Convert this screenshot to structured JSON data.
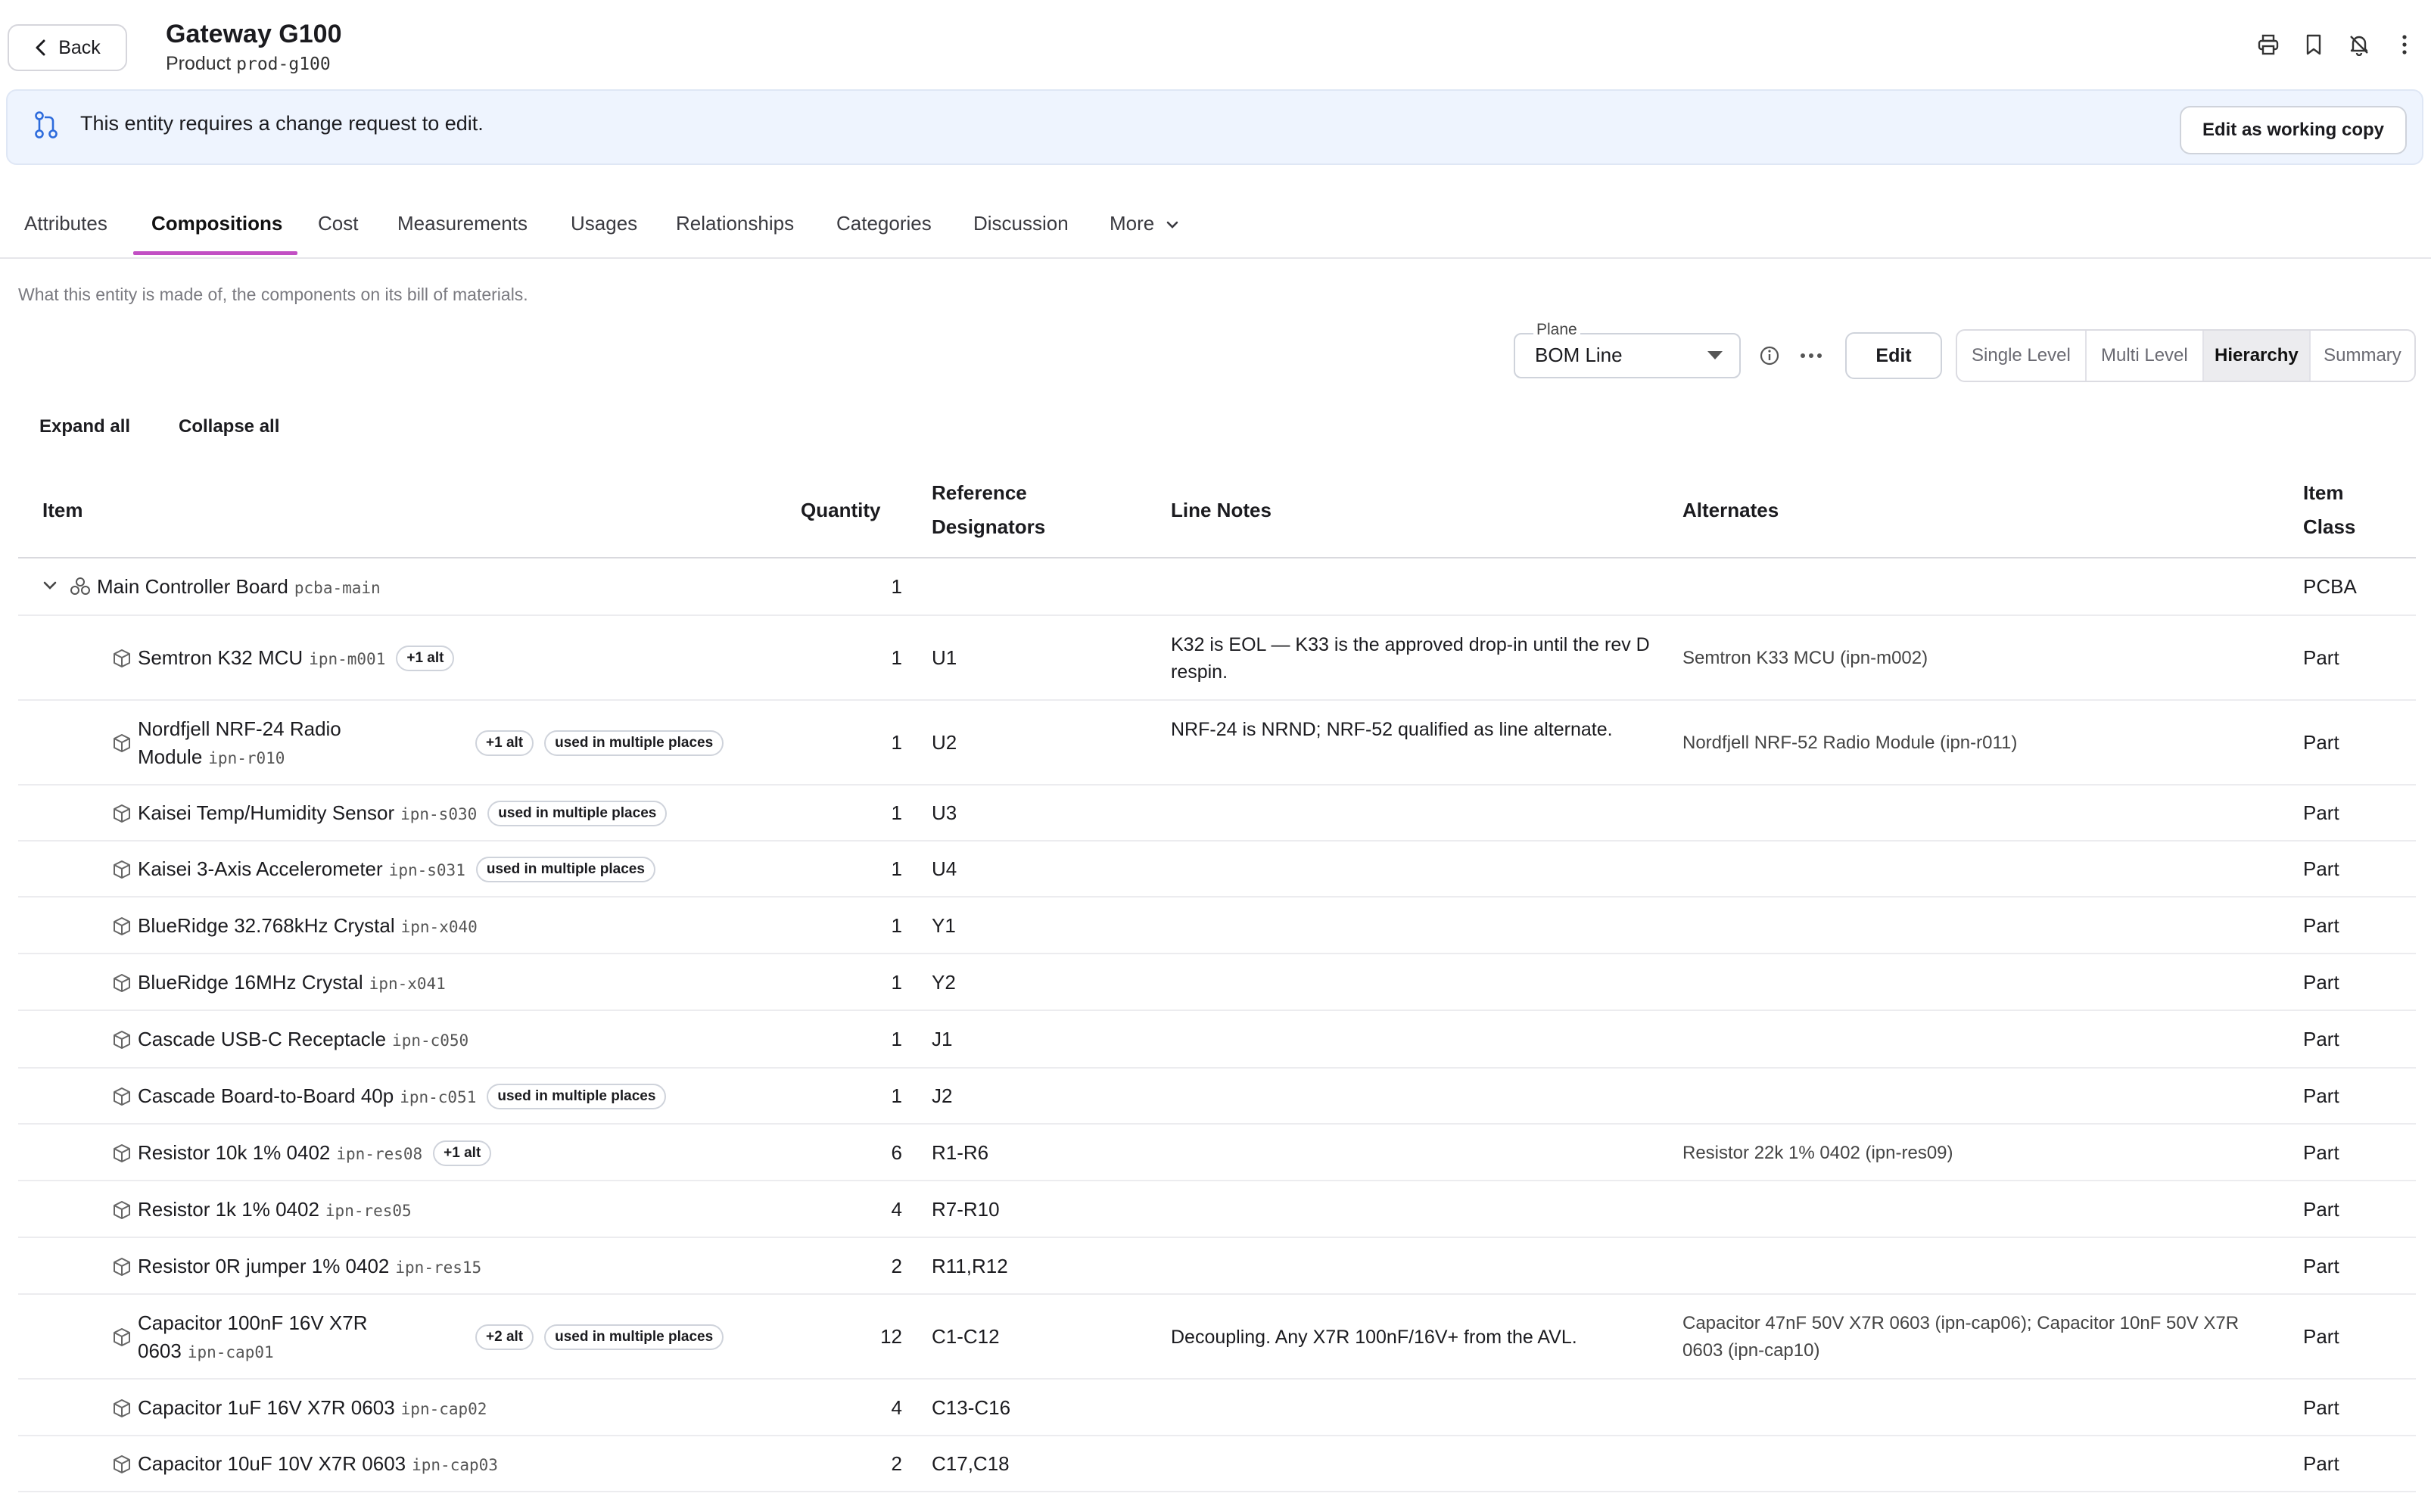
{
  "header": {
    "back_label": "Back",
    "title": "Gateway G100",
    "subtitle_prefix": "Product",
    "subtitle_id": "prod-g100",
    "icons": [
      "print-icon",
      "bookmark-icon",
      "bell-off-icon",
      "kebab-menu-icon"
    ]
  },
  "banner": {
    "text": "This entity requires a change request to edit.",
    "button": "Edit as working copy",
    "icon": "git-pull-request-icon"
  },
  "tabs": [
    {
      "label": "Attributes"
    },
    {
      "label": "Compositions",
      "active": true
    },
    {
      "label": "Cost"
    },
    {
      "label": "Measurements"
    },
    {
      "label": "Usages"
    },
    {
      "label": "Relationships"
    },
    {
      "label": "Categories"
    },
    {
      "label": "Discussion"
    },
    {
      "label": "More"
    }
  ],
  "description": "What this entity is made of, the components on its bill of materials.",
  "controls": {
    "plane_label": "Plane",
    "plane_value": "BOM Line",
    "edit_label": "Edit",
    "views": [
      "Single Level",
      "Multi Level",
      "Hierarchy",
      "Summary"
    ],
    "active_view": "Hierarchy",
    "expand_all": "Expand all",
    "collapse_all": "Collapse all"
  },
  "table": {
    "headers": {
      "item": "Item",
      "quantity": "Quantity",
      "refdes_1": "Reference",
      "refdes_2": "Designators",
      "line_notes": "Line Notes",
      "alternates": "Alternates",
      "item_class_1": "Item",
      "item_class_2": "Class"
    },
    "parent": {
      "name": "Main Controller Board",
      "ipn": "pcba-main",
      "qty": "1",
      "class": "PCBA"
    },
    "rows": [
      {
        "name": "Semtron K32 MCU",
        "ipn": "ipn-m001",
        "alt_badge": "+1 alt",
        "multi_badge": "",
        "qty": "1",
        "refdes": "U1",
        "notes": "K32 is EOL — K33 is the approved drop-in until the rev D respin.",
        "alternates": "Semtron K33 MCU (ipn-m002)",
        "class": "Part"
      },
      {
        "name": "Nordfjell NRF-24 Radio Module",
        "ipn": "ipn-r010",
        "alt_badge": "+1 alt",
        "multi_badge": "used in multiple places",
        "qty": "1",
        "refdes": "U2",
        "notes": "NRF-24 is NRND; NRF-52 qualified as line alternate.",
        "alternates": "Nordfjell NRF-52 Radio Module (ipn-r011)",
        "class": "Part"
      },
      {
        "name": "Kaisei Temp/Humidity Sensor",
        "ipn": "ipn-s030",
        "alt_badge": "",
        "multi_badge": "used in multiple places",
        "qty": "1",
        "refdes": "U3",
        "notes": "",
        "alternates": "",
        "class": "Part"
      },
      {
        "name": "Kaisei 3-Axis Accelerometer",
        "ipn": "ipn-s031",
        "alt_badge": "",
        "multi_badge": "used in multiple places",
        "qty": "1",
        "refdes": "U4",
        "notes": "",
        "alternates": "",
        "class": "Part"
      },
      {
        "name": "BlueRidge 32.768kHz Crystal",
        "ipn": "ipn-x040",
        "alt_badge": "",
        "multi_badge": "",
        "qty": "1",
        "refdes": "Y1",
        "notes": "",
        "alternates": "",
        "class": "Part"
      },
      {
        "name": "BlueRidge 16MHz Crystal",
        "ipn": "ipn-x041",
        "alt_badge": "",
        "multi_badge": "",
        "qty": "1",
        "refdes": "Y2",
        "notes": "",
        "alternates": "",
        "class": "Part"
      },
      {
        "name": "Cascade USB-C Receptacle",
        "ipn": "ipn-c050",
        "alt_badge": "",
        "multi_badge": "",
        "qty": "1",
        "refdes": "J1",
        "notes": "",
        "alternates": "",
        "class": "Part"
      },
      {
        "name": "Cascade Board-to-Board 40p",
        "ipn": "ipn-c051",
        "alt_badge": "",
        "multi_badge": "used in multiple places",
        "qty": "1",
        "refdes": "J2",
        "notes": "",
        "alternates": "",
        "class": "Part"
      },
      {
        "name": "Resistor 10k 1% 0402",
        "ipn": "ipn-res08",
        "alt_badge": "+1 alt",
        "multi_badge": "",
        "qty": "6",
        "refdes": "R1-R6",
        "notes": "",
        "alternates": "Resistor 22k 1% 0402 (ipn-res09)",
        "class": "Part"
      },
      {
        "name": "Resistor 1k 1% 0402",
        "ipn": "ipn-res05",
        "alt_badge": "",
        "multi_badge": "",
        "qty": "4",
        "refdes": "R7-R10",
        "notes": "",
        "alternates": "",
        "class": "Part"
      },
      {
        "name": "Resistor 0R jumper 1% 0402",
        "ipn": "ipn-res15",
        "alt_badge": "",
        "multi_badge": "",
        "qty": "2",
        "refdes": "R11,R12",
        "notes": "",
        "alternates": "",
        "class": "Part"
      },
      {
        "name": "Capacitor 100nF 16V X7R 0603",
        "ipn": "ipn-cap01",
        "alt_badge": "+2 alt",
        "multi_badge": "used in multiple places",
        "qty": "12",
        "refdes": "C1-C12",
        "notes": "Decoupling. Any X7R 100nF/16V+ from the AVL.",
        "alternates": "Capacitor 47nF 50V X7R 0603 (ipn-cap06); Capacitor 10nF 50V X7R 0603 (ipn-cap10)",
        "class": "Part"
      },
      {
        "name": "Capacitor 1uF 16V X7R 0603",
        "ipn": "ipn-cap02",
        "alt_badge": "",
        "multi_badge": "",
        "qty": "4",
        "refdes": "C13-C16",
        "notes": "",
        "alternates": "",
        "class": "Part"
      },
      {
        "name": "Capacitor 10uF 10V X7R 0603",
        "ipn": "ipn-cap03",
        "alt_badge": "",
        "multi_badge": "",
        "qty": "2",
        "refdes": "C17,C18",
        "notes": "",
        "alternates": "",
        "class": "Part"
      }
    ]
  }
}
